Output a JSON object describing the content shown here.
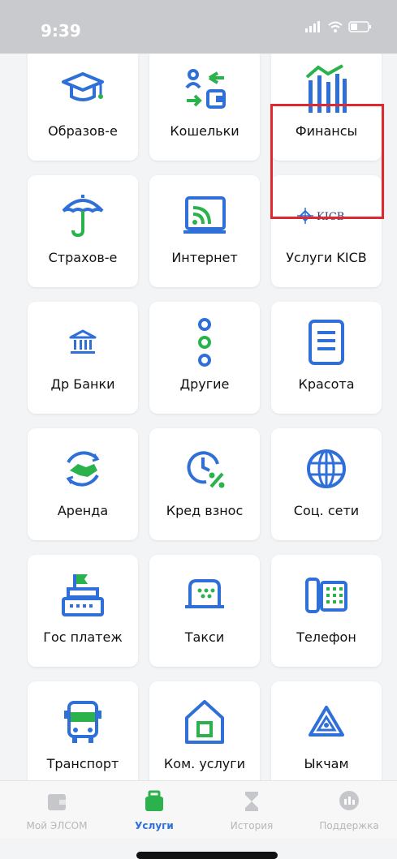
{
  "status": {
    "time": "9:39"
  },
  "tiles": [
    {
      "label": "Образов-е",
      "icon": "graduation-cap-icon"
    },
    {
      "label": "Кошельки",
      "icon": "wallet-exchange-icon"
    },
    {
      "label": "Финансы",
      "icon": "finance-chart-icon"
    },
    {
      "label": "Страхов-е",
      "icon": "umbrella-icon"
    },
    {
      "label": "Интернет",
      "icon": "wifi-screen-icon"
    },
    {
      "label": "Услуги KICB",
      "icon": "kicb-logo",
      "logo_text": "KICB"
    },
    {
      "label": "Др Банки",
      "icon": "bank-icon"
    },
    {
      "label": "Другие",
      "icon": "more-dots-icon"
    },
    {
      "label": "Красота",
      "icon": "document-icon"
    },
    {
      "label": "Аренда",
      "icon": "handshake-icon"
    },
    {
      "label": "Кред взнос",
      "icon": "clock-percent-icon"
    },
    {
      "label": "Соц. сети",
      "icon": "globe-icon"
    },
    {
      "label": "Гос платеж",
      "icon": "cash-register-icon"
    },
    {
      "label": "Такси",
      "icon": "taxi-icon"
    },
    {
      "label": "Телефон",
      "icon": "phone-icon"
    },
    {
      "label": "Транспорт",
      "icon": "bus-icon"
    },
    {
      "label": "Ком. услуги",
      "icon": "home-icon"
    },
    {
      "label": "Ыкчам",
      "icon": "ykcham-logo-icon"
    }
  ],
  "highlighted_tile": "Финансы",
  "tabbar": [
    {
      "label": "Мой ЭЛСОМ",
      "icon": "wallet-icon",
      "active": false
    },
    {
      "label": "Услуги",
      "icon": "services-icon",
      "active": true
    },
    {
      "label": "История",
      "icon": "hourglass-icon",
      "active": false
    },
    {
      "label": "Поддержка",
      "icon": "support-chat-icon",
      "active": false
    }
  ],
  "colors": {
    "primary_blue": "#2f6fd8",
    "accent_green": "#2bb24c",
    "highlight_red": "#e0282e"
  }
}
